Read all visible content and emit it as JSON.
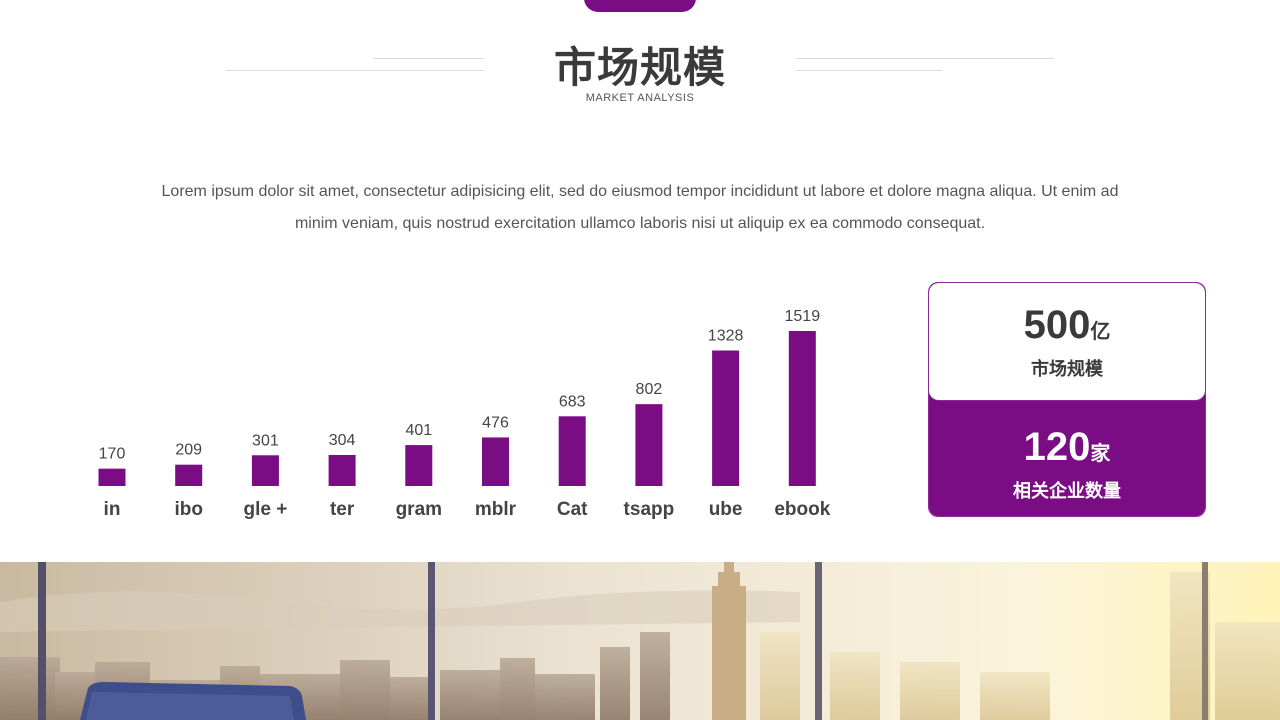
{
  "header": {
    "title": "市场规模",
    "subtitle": "MARKET ANALYSIS"
  },
  "description": {
    "line1": "Lorem ipsum dolor sit amet, consectetur adipisicing elit, sed do eiusmod tempor incididunt ut labore et dolore magna aliqua. Ut enim ad",
    "line2": "minim veniam, quis nostrud exercitation ullamco laboris nisi ut aliquip ex ea commodo consequat."
  },
  "chart_data": {
    "type": "bar",
    "categories": [
      "in",
      "ibo",
      "gle +",
      "ter",
      "gram",
      "mblr",
      "Cat",
      "tsapp",
      "ube",
      "ebook"
    ],
    "values": [
      170,
      209,
      301,
      304,
      401,
      476,
      683,
      802,
      1328,
      1519
    ],
    "title": "",
    "xlabel": "",
    "ylabel": "",
    "ylim": [
      0,
      1519
    ],
    "grid": false,
    "legend": "none",
    "bar_color": "#7a0c84"
  },
  "stats": {
    "market": {
      "value": "500",
      "unit": "亿",
      "label": "市场规模"
    },
    "companies": {
      "value": "120",
      "unit": "家",
      "label": "相关企业数量"
    }
  },
  "colors": {
    "accent": "#7a0c84",
    "text_dark": "#3a3a3a"
  }
}
